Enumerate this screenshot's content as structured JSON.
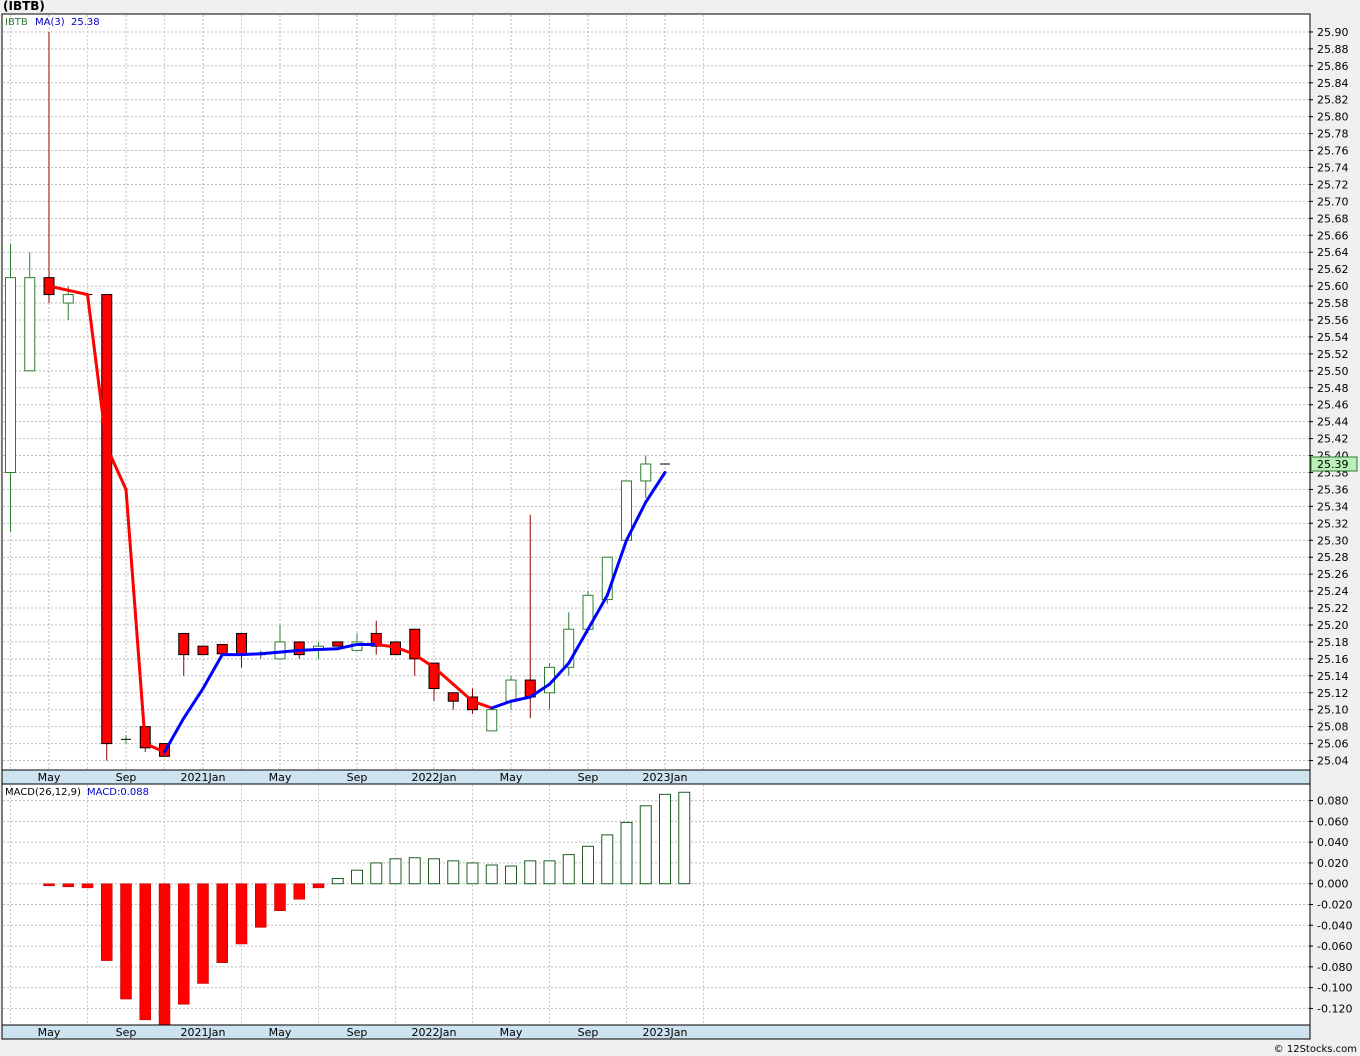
{
  "title": "(IBTB)",
  "watermark": "© 12Stocks.com",
  "colors": {
    "up": "#2e7d32",
    "down": "#ff0000",
    "ma_down": "#ff0000",
    "ma_up": "#0000ff",
    "last_price_bg": "#b8f0b8"
  },
  "chart_data": [
    {
      "type": "candlestick",
      "symbol": "IBTB",
      "legend": {
        "symbol": "IBTB",
        "ma_label": "MA(3)",
        "ma_value": "25.38"
      },
      "last_price": "25.39",
      "ylim": [
        25.03,
        25.92
      ],
      "y_ticks": [
        "25.90",
        "25.88",
        "25.86",
        "25.84",
        "25.82",
        "25.80",
        "25.78",
        "25.76",
        "25.74",
        "25.72",
        "25.70",
        "25.68",
        "25.66",
        "25.64",
        "25.62",
        "25.60",
        "25.58",
        "25.56",
        "25.54",
        "25.52",
        "25.50",
        "25.48",
        "25.46",
        "25.44",
        "25.42",
        "25.40",
        "25.38",
        "25.36",
        "25.34",
        "25.32",
        "25.30",
        "25.28",
        "25.26",
        "25.24",
        "25.22",
        "25.20",
        "25.18",
        "25.16",
        "25.14",
        "25.12",
        "25.10",
        "25.08",
        "25.06",
        "25.04"
      ],
      "x_ticks": [
        {
          "i": 2,
          "label": "May"
        },
        {
          "i": 6,
          "label": "Sep"
        },
        {
          "i": 10,
          "label": "2021Jan"
        },
        {
          "i": 14,
          "label": "May"
        },
        {
          "i": 18,
          "label": "Sep"
        },
        {
          "i": 22,
          "label": "2022Jan"
        },
        {
          "i": 26,
          "label": "May"
        },
        {
          "i": 30,
          "label": "Sep"
        },
        {
          "i": 34,
          "label": "2023Jan"
        }
      ],
      "candles": [
        {
          "o": 25.38,
          "h": 25.65,
          "l": 25.31,
          "c": 25.61
        },
        {
          "o": 25.5,
          "h": 25.64,
          "l": 25.5,
          "c": 25.61
        },
        {
          "o": 25.61,
          "h": 25.9,
          "l": 25.58,
          "c": 25.59
        },
        {
          "o": 25.58,
          "h": 25.6,
          "l": 25.56,
          "c": 25.59
        },
        {
          "o": 25.59,
          "h": 25.59,
          "l": 25.59,
          "c": 25.59
        },
        {
          "o": 25.59,
          "h": 25.59,
          "l": 25.04,
          "c": 25.06
        },
        {
          "o": 25.065,
          "h": 25.07,
          "l": 25.06,
          "c": 25.065
        },
        {
          "o": 25.08,
          "h": 25.08,
          "l": 25.05,
          "c": 25.055
        },
        {
          "o": 25.06,
          "h": 25.06,
          "l": 25.045,
          "c": 25.045
        },
        {
          "o": 25.19,
          "h": 25.19,
          "l": 25.14,
          "c": 25.165
        },
        {
          "o": 25.175,
          "h": 25.175,
          "l": 25.165,
          "c": 25.165
        },
        {
          "o": 25.177,
          "h": 25.177,
          "l": 25.166,
          "c": 25.166
        },
        {
          "o": 25.19,
          "h": 25.19,
          "l": 25.15,
          "c": 25.165
        },
        {
          "o": 25.165,
          "h": 25.17,
          "l": 25.16,
          "c": 25.165
        },
        {
          "o": 25.16,
          "h": 25.2,
          "l": 25.16,
          "c": 25.18
        },
        {
          "o": 25.18,
          "h": 25.18,
          "l": 25.16,
          "c": 25.165
        },
        {
          "o": 25.172,
          "h": 25.18,
          "l": 25.16,
          "c": 25.175
        },
        {
          "o": 25.18,
          "h": 25.18,
          "l": 25.175,
          "c": 25.175
        },
        {
          "o": 25.17,
          "h": 25.19,
          "l": 25.17,
          "c": 25.18
        },
        {
          "o": 25.19,
          "h": 25.205,
          "l": 25.165,
          "c": 25.175
        },
        {
          "o": 25.18,
          "h": 25.18,
          "l": 25.165,
          "c": 25.165
        },
        {
          "o": 25.195,
          "h": 25.195,
          "l": 25.14,
          "c": 25.16
        },
        {
          "o": 25.155,
          "h": 25.155,
          "l": 25.11,
          "c": 25.125
        },
        {
          "o": 25.12,
          "h": 25.12,
          "l": 25.1,
          "c": 25.11
        },
        {
          "o": 25.115,
          "h": 25.125,
          "l": 25.095,
          "c": 25.1
        },
        {
          "o": 25.075,
          "h": 25.1,
          "l": 25.075,
          "c": 25.1
        },
        {
          "o": 25.11,
          "h": 25.14,
          "l": 25.1,
          "c": 25.135
        },
        {
          "o": 25.135,
          "h": 25.33,
          "l": 25.09,
          "c": 25.115
        },
        {
          "o": 25.12,
          "h": 25.155,
          "l": 25.1,
          "c": 25.15
        },
        {
          "o": 25.15,
          "h": 25.215,
          "l": 25.14,
          "c": 25.195
        },
        {
          "o": 25.195,
          "h": 25.24,
          "l": 25.19,
          "c": 25.235
        },
        {
          "o": 25.23,
          "h": 25.28,
          "l": 25.225,
          "c": 25.28
        },
        {
          "o": 25.3,
          "h": 25.37,
          "l": 25.3,
          "c": 25.37
        },
        {
          "o": 25.37,
          "h": 25.4,
          "l": 25.35,
          "c": 25.39
        },
        {
          "o": 25.39,
          "h": 25.39,
          "l": 25.39,
          "c": 25.39
        }
      ],
      "ma3": [
        null,
        null,
        25.6,
        25.595,
        25.59,
        25.41,
        25.36,
        25.06,
        25.05,
        25.09,
        25.125,
        25.165,
        25.165,
        25.166,
        25.168,
        25.17,
        25.171,
        25.172,
        25.177,
        25.177,
        25.174,
        25.165,
        25.15,
        25.13,
        25.11,
        25.102,
        25.11,
        25.115,
        25.13,
        25.155,
        25.195,
        25.235,
        25.3,
        25.345,
        25.38
      ],
      "ma3_down_segments": [
        [
          2,
          8
        ],
        [
          19,
          25
        ]
      ]
    },
    {
      "type": "bar",
      "legend": {
        "label": "MACD(26,12,9)",
        "value_label": "MACD:0.088"
      },
      "ylim": [
        -0.135,
        0.095
      ],
      "y_ticks": [
        "0.080",
        "0.060",
        "0.040",
        "0.020",
        "0.000",
        "-0.020",
        "-0.040",
        "-0.060",
        "-0.080",
        "-0.100",
        "-0.120"
      ],
      "values": [
        null,
        null,
        -0.002,
        -0.003,
        -0.004,
        -0.074,
        -0.111,
        -0.131,
        -0.136,
        -0.116,
        -0.096,
        -0.076,
        -0.058,
        -0.042,
        -0.026,
        -0.015,
        -0.004,
        0.005,
        0.013,
        0.02,
        0.024,
        0.025,
        0.024,
        0.022,
        0.02,
        0.018,
        0.017,
        0.022,
        0.022,
        0.028,
        0.036,
        0.047,
        0.059,
        0.075,
        0.086,
        0.088
      ],
      "x_ticks": [
        {
          "i": 2,
          "label": "May"
        },
        {
          "i": 6,
          "label": "Sep"
        },
        {
          "i": 10,
          "label": "2021Jan"
        },
        {
          "i": 14,
          "label": "May"
        },
        {
          "i": 18,
          "label": "Sep"
        },
        {
          "i": 22,
          "label": "2022Jan"
        },
        {
          "i": 26,
          "label": "May"
        },
        {
          "i": 30,
          "label": "Sep"
        },
        {
          "i": 34,
          "label": "2023Jan"
        }
      ]
    }
  ]
}
